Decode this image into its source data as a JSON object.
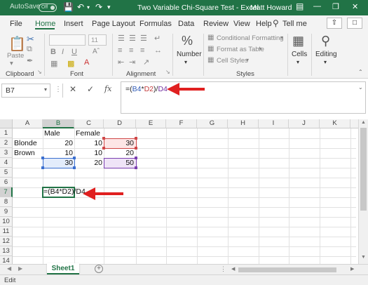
{
  "titlebar": {
    "autosave_label": "AutoSave",
    "autosave_state": "Off",
    "title": "Two Variable Chi-Square Test  -  Excel",
    "user": "Matt Howard",
    "bg_color": "#217346"
  },
  "tabs": [
    "File",
    "Home",
    "Insert",
    "Page Layout",
    "Formulas",
    "Data",
    "Review",
    "View",
    "Help"
  ],
  "active_tab": "Home",
  "tell_me": "Tell me",
  "ribbon": {
    "paste_label": "Paste",
    "font_size": "11",
    "number_label": "Number",
    "conditional_formatting": "Conditional Formatting",
    "format_as_table": "Format as Table",
    "cell_styles": "Cell Styles",
    "cells_label": "Cells",
    "editing_label": "Editing",
    "groups": {
      "clipboard": "Clipboard",
      "font": "Font",
      "alignment": "Alignment",
      "styles": "Styles"
    }
  },
  "formula_bar": {
    "name_box": "B7",
    "formula_parts": [
      "=(",
      "B4",
      "*",
      "D2",
      ")/",
      "D4"
    ]
  },
  "grid": {
    "columns": [
      "A",
      "B",
      "C",
      "D",
      "E",
      "F",
      "G",
      "H",
      "I",
      "J",
      "K"
    ],
    "rows": [
      "1",
      "2",
      "3",
      "4",
      "5",
      "6",
      "7",
      "8",
      "9",
      "10",
      "11",
      "12",
      "13",
      "14"
    ],
    "selected_column": "B",
    "selected_row": "7",
    "cells": {
      "B1": "Male",
      "C1": "Female",
      "A2": "Blonde",
      "B2": "20",
      "C2": "10",
      "D2": "30",
      "A3": "Brown",
      "B3": "10",
      "C3": "10",
      "D3": "20",
      "B4": "30",
      "C4": "20",
      "D4": "50",
      "B7": "=(B4*D2)/D4"
    }
  },
  "sheets": [
    "Sheet1"
  ],
  "status": "Edit",
  "colors": {
    "accent": "#217346",
    "arrow": "#e02020",
    "ref_blue": "#2f5bb7",
    "ref_red": "#c43b3b",
    "ref_purple": "#7030a0"
  }
}
